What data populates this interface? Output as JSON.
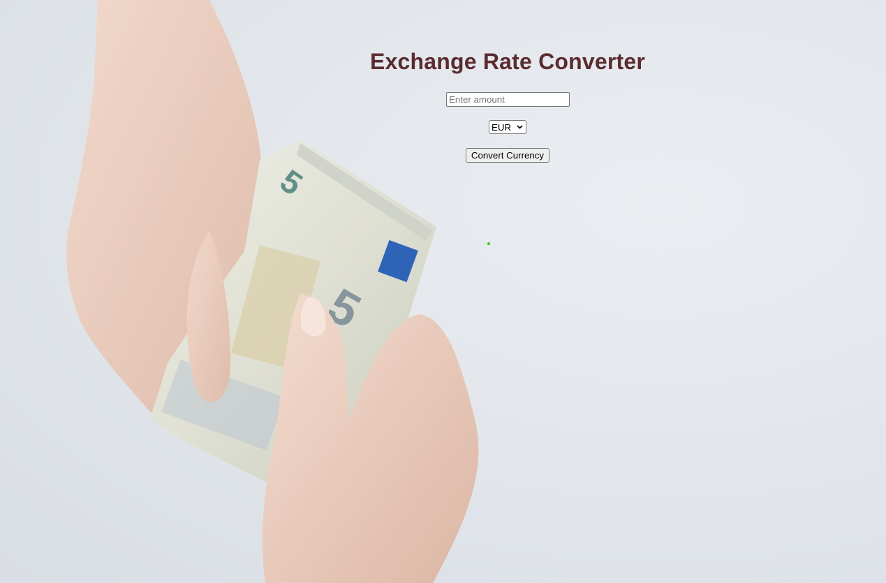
{
  "page": {
    "title": "Exchange Rate Converter"
  },
  "form": {
    "amount_placeholder": "Enter amount",
    "amount_value": "",
    "currency_selected": "EUR",
    "convert_label": "Convert Currency"
  },
  "colors": {
    "title": "#5a2b2f",
    "background": "#e1e5ea",
    "result_dot": "#33cc00"
  },
  "icons": {
    "select_arrow": "chevron-down-icon"
  }
}
